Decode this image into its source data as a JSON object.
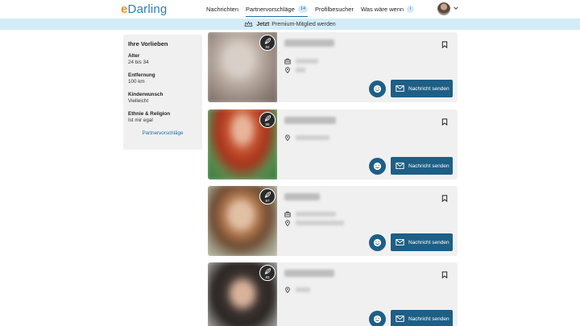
{
  "header": {
    "logo_prefix": "e",
    "logo_text": "Darling",
    "nav": [
      {
        "label": "Nachrichten"
      },
      {
        "label": "Partnervorschläge",
        "badge": "14"
      },
      {
        "label": "Profilbesucher"
      },
      {
        "label": "Was wäre wenn",
        "badge": "i"
      }
    ]
  },
  "banner": {
    "bold": "Jetzt",
    "text": "Premium-Mitglied werden"
  },
  "sidebar": {
    "title": "Ihre Vorlieben",
    "items": [
      {
        "label": "Alter",
        "value": "24 bis 34"
      },
      {
        "label": "Entfernung",
        "value": "100 km"
      },
      {
        "label": "Kinderwunsch",
        "value": "Vielleicht"
      },
      {
        "label": "Ethnie & Religion",
        "value": "Ist mir egal"
      }
    ],
    "link": "Partnervorschläge"
  },
  "cards": [
    {
      "match": "83",
      "button": "Nachricht senden"
    },
    {
      "match": "88",
      "button": "Nachricht senden"
    },
    {
      "match": "87",
      "button": "Nachricht senden"
    },
    {
      "match": "83",
      "button": "Nachricht senden"
    }
  ],
  "colors": {
    "brand": "#2a7fb8",
    "accent": "#f28c28",
    "button": "#1d5f86",
    "banner": "#d3ecf8",
    "card": "#f0f0f0"
  }
}
